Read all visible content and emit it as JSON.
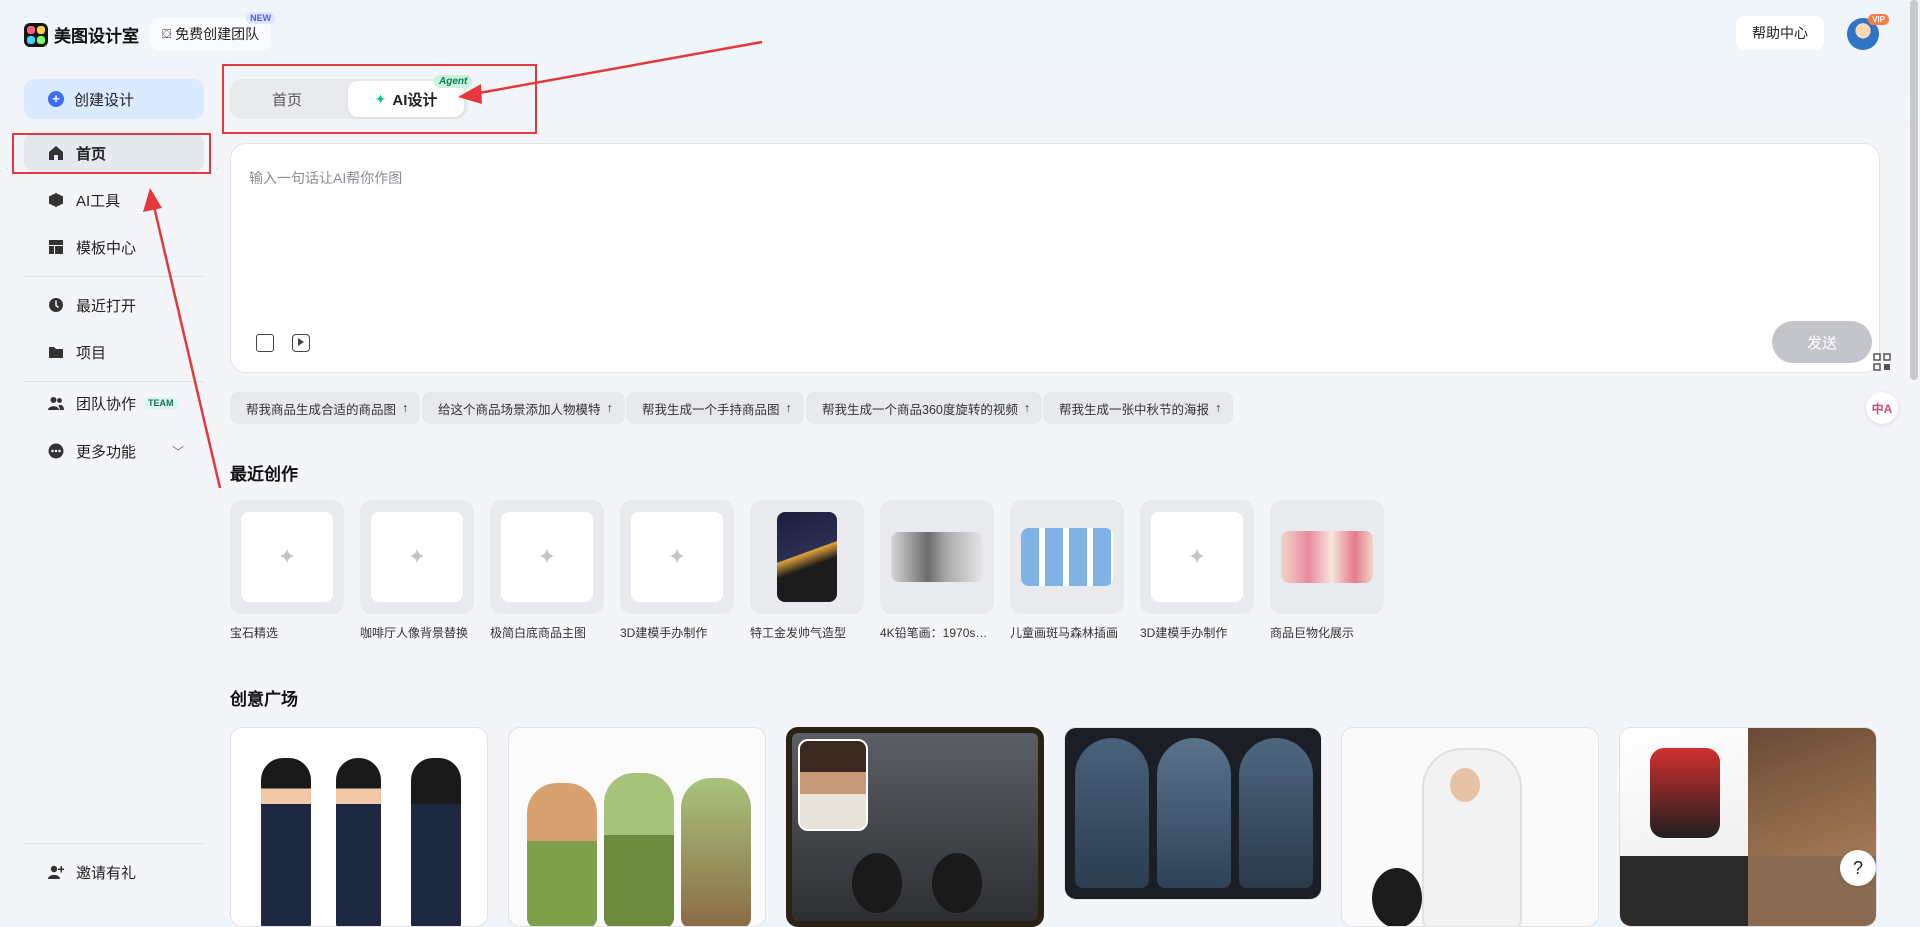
{
  "app": {
    "title": "美图设计室"
  },
  "header": {
    "team_button": "免费创建团队",
    "new_badge": "NEW",
    "help_button": "帮助中心",
    "vip_badge": "VIP"
  },
  "sidebar": {
    "create_button": "创建设计",
    "items": [
      {
        "label": "首页",
        "icon": "home-icon",
        "active": true
      },
      {
        "label": "AI工具",
        "icon": "cube-icon"
      },
      {
        "label": "模板中心",
        "icon": "template-icon"
      },
      {
        "label": "最近打开",
        "icon": "clock-icon"
      },
      {
        "label": "项目",
        "icon": "folder-icon"
      },
      {
        "label": "团队协作",
        "icon": "people-icon",
        "tag": "TEAM"
      },
      {
        "label": "更多功能",
        "icon": "more-icon"
      }
    ],
    "invite": "邀请有礼"
  },
  "mode_tabs": {
    "home": "首页",
    "ai": "AI设计",
    "agent_tag": "Agent"
  },
  "prompt": {
    "placeholder": "输入一句话让AI帮你作图",
    "send": "发送"
  },
  "suggestions": [
    "帮我商品生成合适的商品图",
    "给这个商品场景添加人物模特",
    "帮我生成一个手持商品图",
    "帮我生成一个商品360度旋转的视频",
    "帮我生成一张中秋节的海报"
  ],
  "recent": {
    "title": "最近创作",
    "items": [
      "宝石精选",
      "咖啡厅人像背景替换",
      "极简白底商品主图",
      "3D建模手办制作",
      "特工金发帅气造型",
      "4K铅笔画：1970s…",
      "儿童画斑马森林插画",
      "3D建模手办制作",
      "商品巨物化展示"
    ]
  },
  "gallery": {
    "title": "创意广场"
  },
  "help_fab": "?",
  "colors": {
    "accent": "#3f6cf5",
    "highlight": "#e5383b",
    "background": "#f4f5f8"
  }
}
